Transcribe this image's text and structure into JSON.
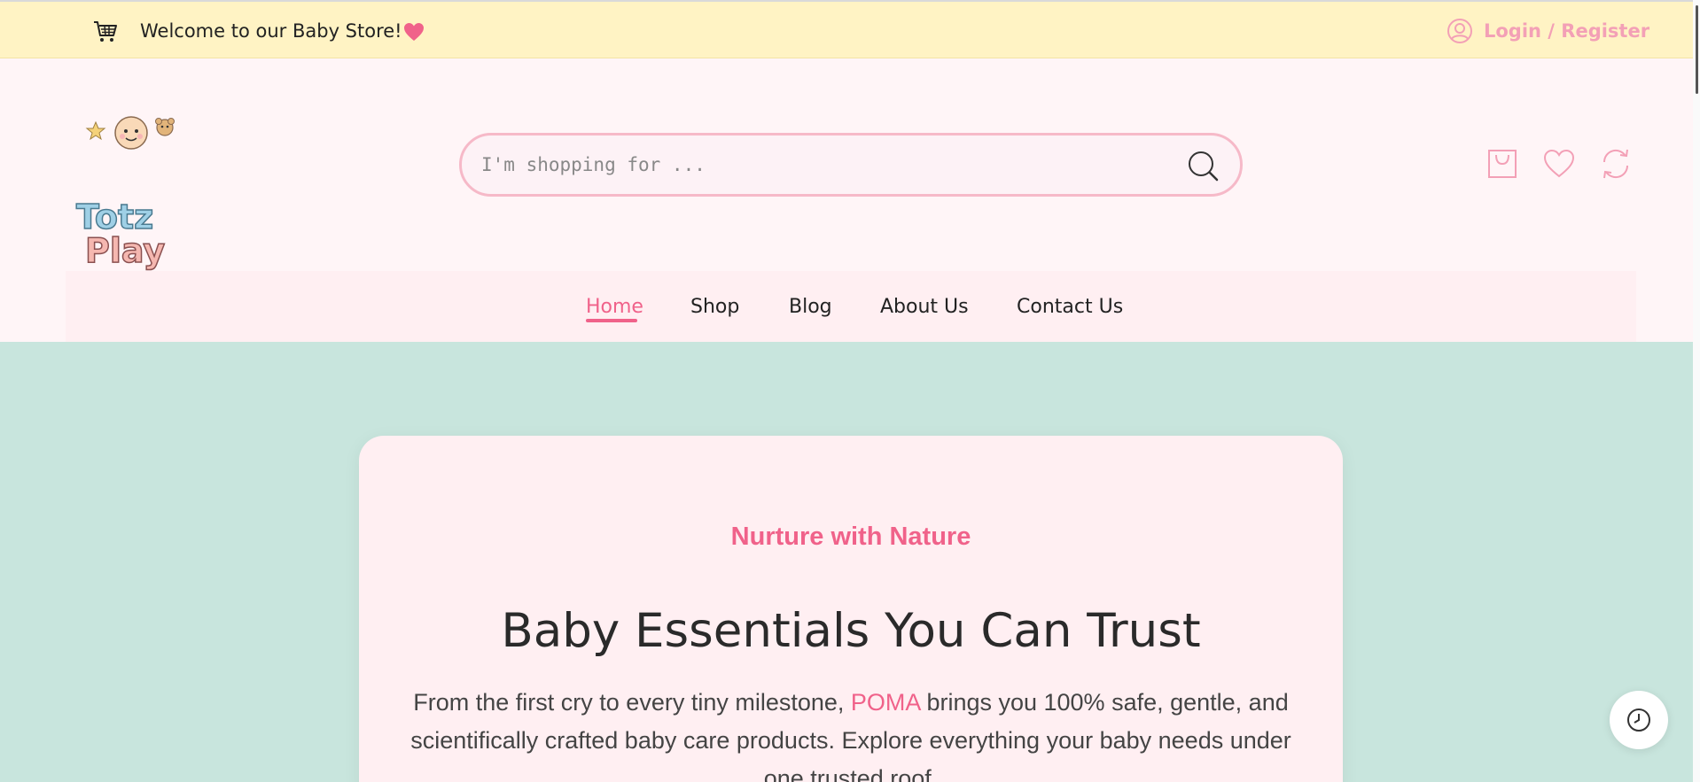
{
  "topbar": {
    "welcome": "Welcome to our Baby Store!",
    "login": "Login / Register",
    "icons": [
      "cart-icon",
      "heart-icon",
      "user-icon"
    ]
  },
  "header": {
    "logo_text": [
      "Totz",
      "Play"
    ],
    "search": {
      "placeholder": "I'm shopping for ...",
      "value": ""
    },
    "icons": [
      "shopping-bag-icon",
      "wishlist-heart-icon",
      "compare-refresh-icon"
    ]
  },
  "nav": {
    "items": [
      {
        "label": "Home",
        "active": true
      },
      {
        "label": "Shop",
        "active": false
      },
      {
        "label": "Blog",
        "active": false
      },
      {
        "label": "About Us",
        "active": false
      },
      {
        "label": "Contact Us",
        "active": false
      }
    ]
  },
  "hero": {
    "tagline": "Nurture with Nature",
    "title": "Baby Essentials You Can Trust",
    "desc_before": "From the first cry to every tiny milestone, ",
    "brand": "POMA",
    "desc_after": " brings you 100% safe, gentle, and scientifically crafted baby care products. Explore everything your baby needs under one trusted roof."
  },
  "colors": {
    "accent": "#f0628a",
    "topbar_bg": "#fff3c4",
    "hero_bg": "#c8e5dd",
    "card_bg": "#ffeff2",
    "login_text": "#f3a0b6"
  }
}
